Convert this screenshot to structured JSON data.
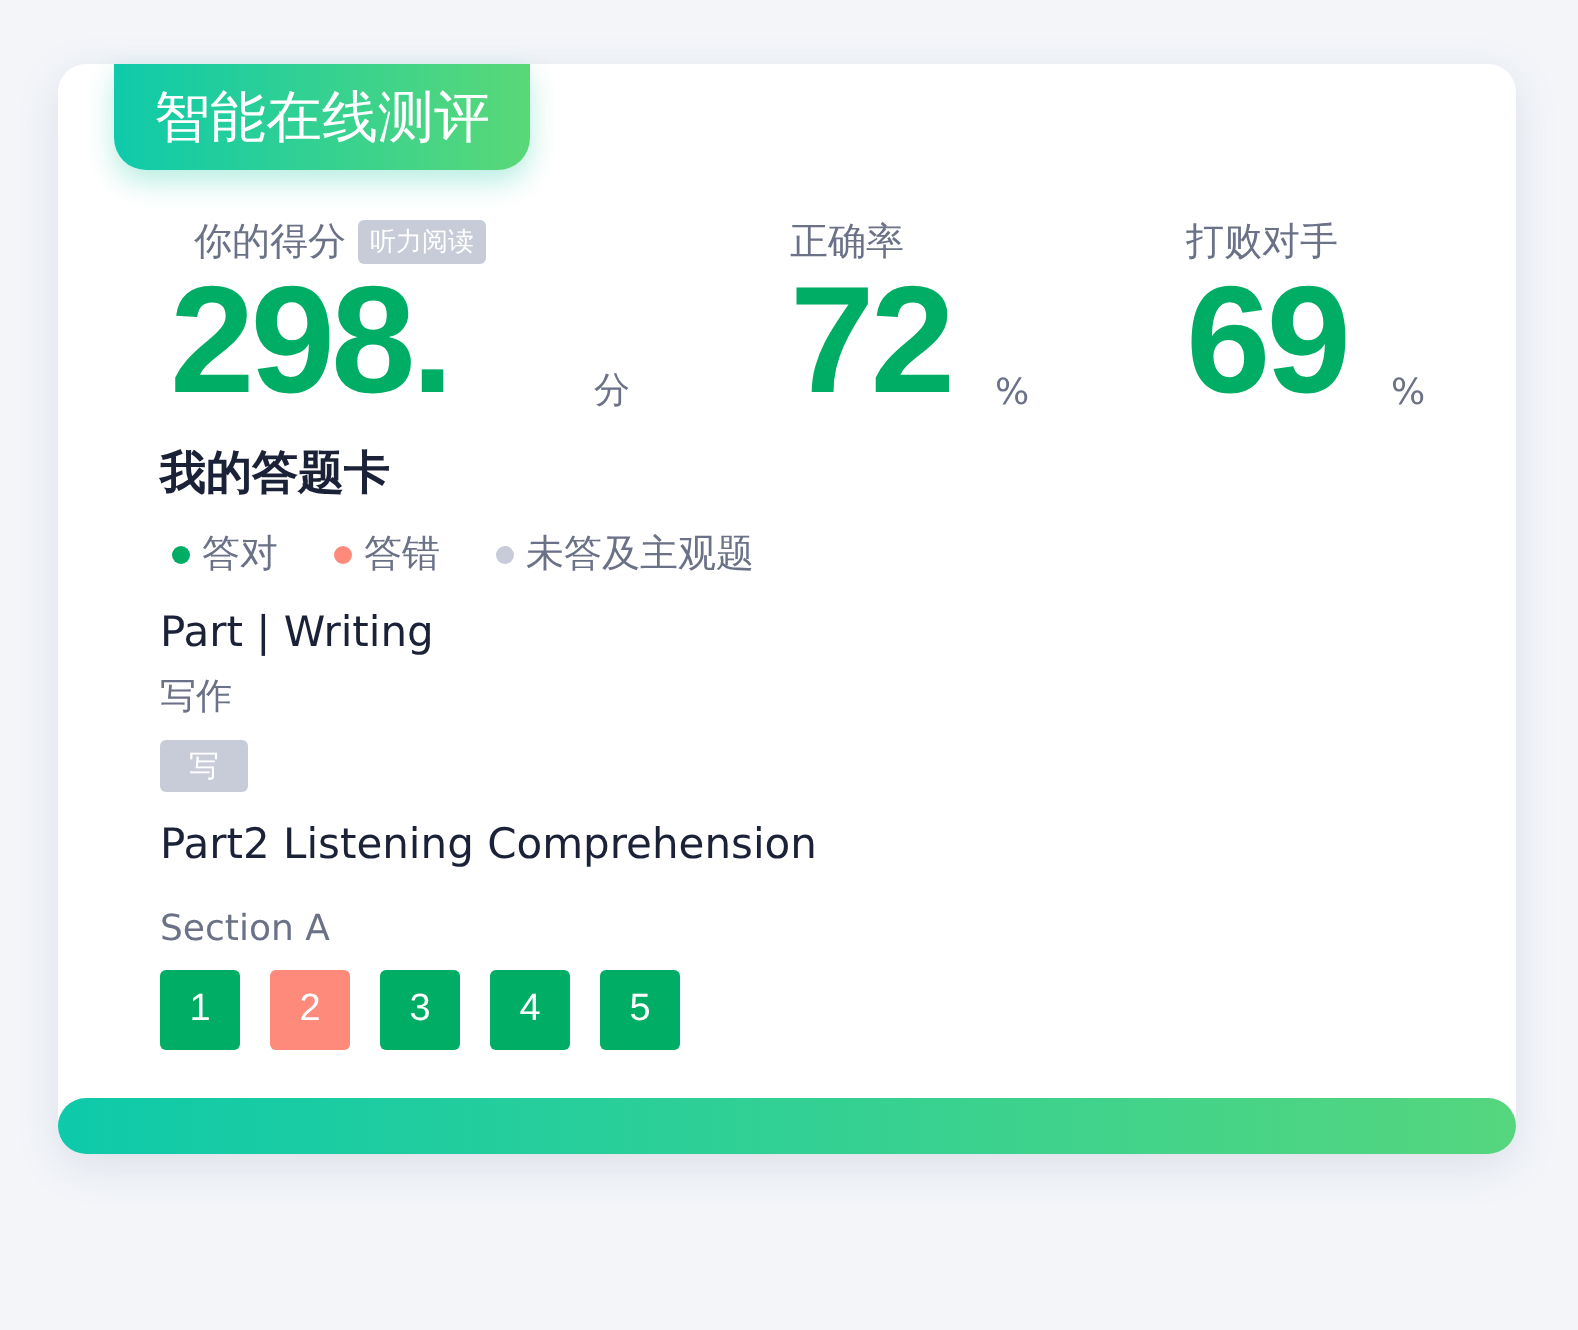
{
  "banner": {
    "title": "智能在线测评"
  },
  "stats": [
    {
      "label": "你的得分",
      "tag": "听力阅读",
      "value": "298.",
      "unit": "分"
    },
    {
      "label": "正确率",
      "value": "72",
      "unit": "%"
    },
    {
      "label": "打败对手",
      "value": "69",
      "unit": "%"
    }
  ],
  "answer_card": {
    "title": "我的答题卡",
    "legend": [
      {
        "label": "答对",
        "color": "#00ad65"
      },
      {
        "label": "答错",
        "color": "#fd8a7a"
      },
      {
        "label": "未答及主观题",
        "color": "#c8ccd8"
      }
    ],
    "parts": [
      {
        "title": "Part | Writing",
        "subtitle": "写作",
        "items": [
          {
            "label": "写",
            "color": "#c8ccd8"
          }
        ]
      },
      {
        "title": "Part2 Listening Comprehension",
        "subtitle": "Section A",
        "items": [
          {
            "label": "1",
            "color": "#00ad65"
          },
          {
            "label": "2",
            "color": "#fd8a7a"
          },
          {
            "label": "3",
            "color": "#00ad65"
          },
          {
            "label": "4",
            "color": "#00ad65"
          },
          {
            "label": "5",
            "color": "#00ad65"
          }
        ]
      }
    ]
  }
}
